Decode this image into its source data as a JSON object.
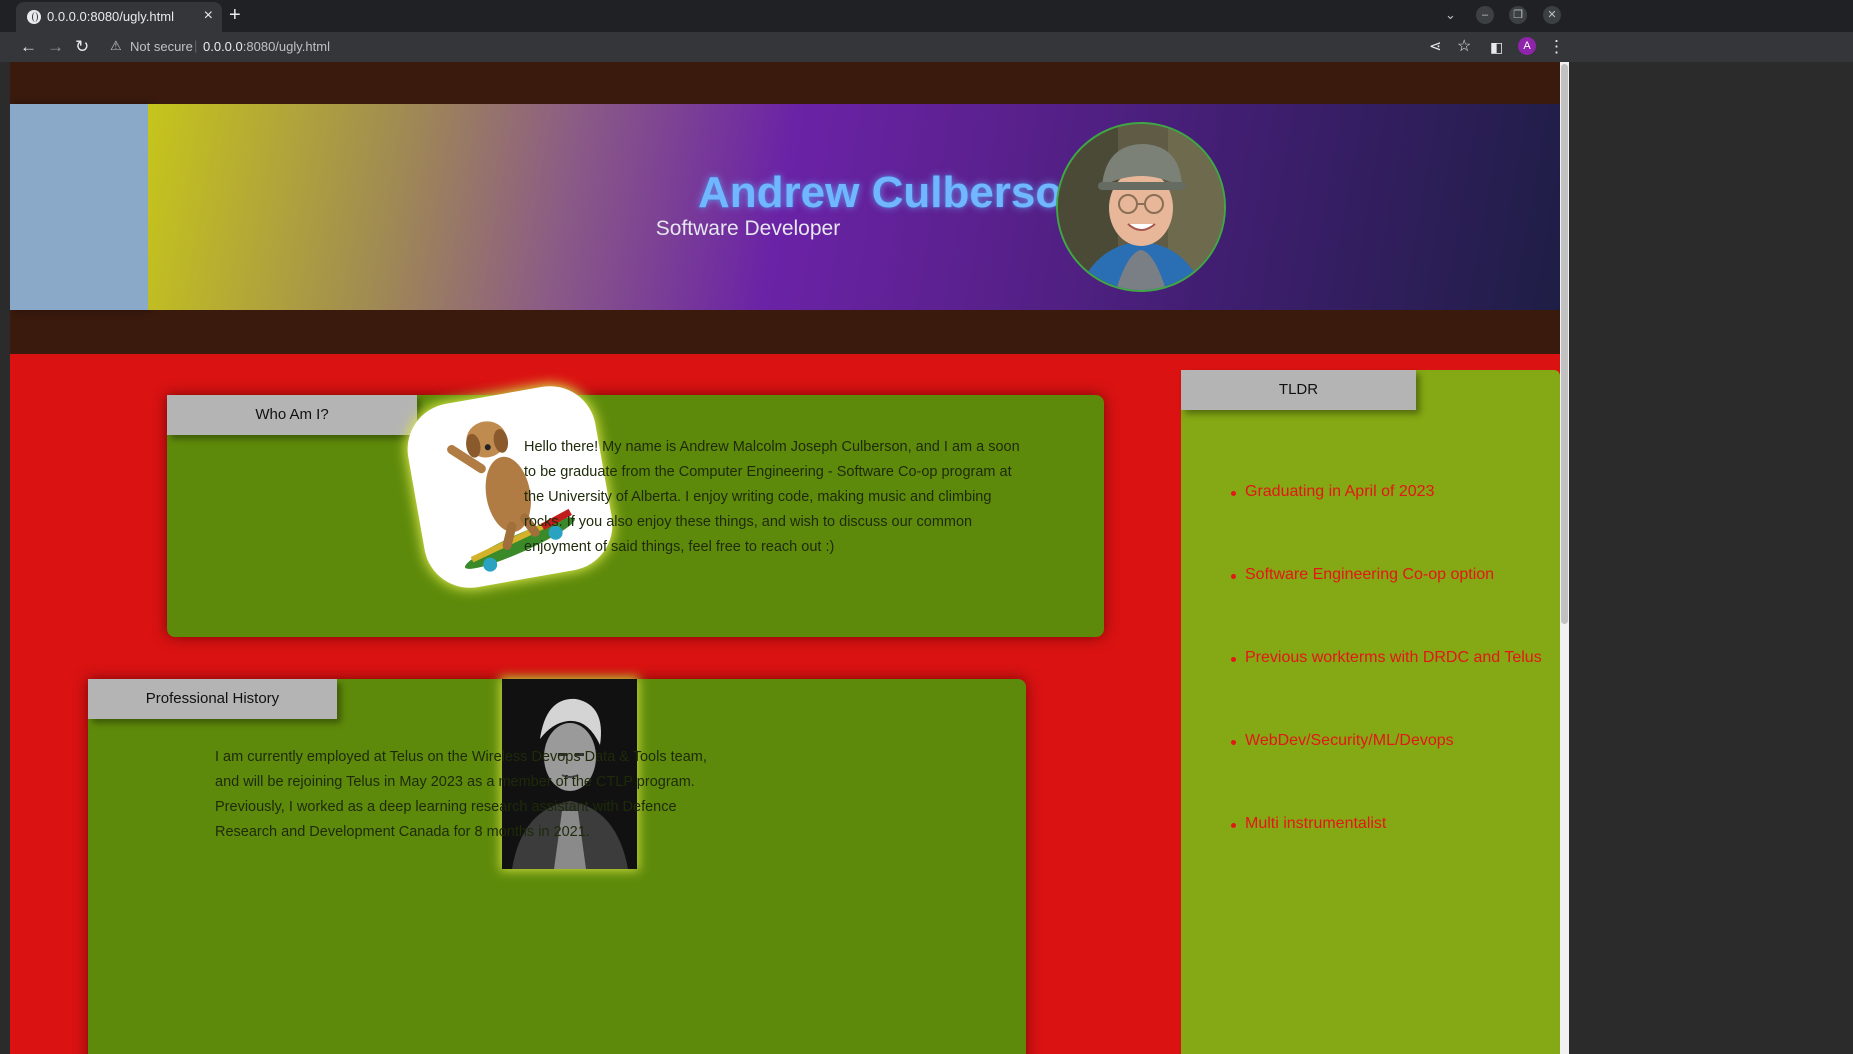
{
  "browser": {
    "tab_title": "0.0.0.0:8080/ugly.html",
    "tab_close": "×",
    "new_tab": "+",
    "security_label": "Not secure",
    "url_host": "0.0.0.0",
    "url_path": ":8080/ugly.html",
    "profile_initial": "A"
  },
  "header": {
    "name": "Andrew Culberson",
    "role": "Software Developer"
  },
  "who": {
    "tab_label": "Who Am I?",
    "text": "Hello there! My name is Andrew Malcolm Joseph Culberson, and I am a soon to be graduate from the Computer Engineering - Software Co-op program at the University of Alberta. I enjoy writing code, making music and climbing rocks. If you also enjoy these things, and wish to discuss our common enjoyment of said things, feel free to reach out :)"
  },
  "professional": {
    "tab_label": "Professional History",
    "text": "I am currently employed at Telus on the Wireless Devops Data & Tools team, and will be rejoining Telus in May 2023 as a member of the CTLP program. Previously, I worked as a deep learning research assistant with Defence Research and Development Canada for 8 months in 2021."
  },
  "tldr": {
    "tab_label": "TLDR",
    "items": [
      "Graduating in April of 2023",
      "Software Engineering Co-op option",
      "Previous workterms with DRDC and Telus",
      "WebDev/Security/ML/Devops",
      "Multi instrumentalist"
    ]
  },
  "colors": {
    "page_background": "#da1212",
    "top_band": "#3a1a0d",
    "card_green": "#5e8a0b",
    "tldr_green": "#84a914",
    "tab_grey": "#b4b4b4",
    "name_blue": "#70b7ff",
    "tldr_text_red": "#e41616"
  }
}
